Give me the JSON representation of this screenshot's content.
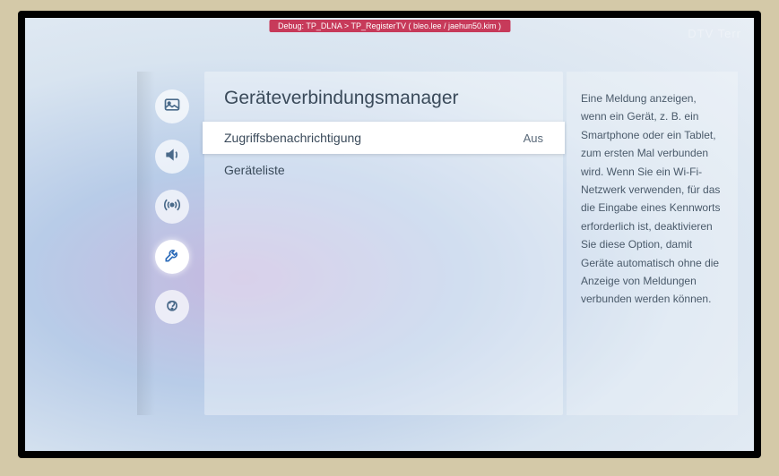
{
  "debug": {
    "text": "Debug: TP_DLNA > TP_RegisterTV  ( bleo.lee / jaehun50.kim )"
  },
  "topRight": "DTV Terr",
  "sidebar": {
    "items": [
      {
        "name": "picture-icon"
      },
      {
        "name": "sound-icon"
      },
      {
        "name": "broadcast-icon"
      },
      {
        "name": "general-icon"
      },
      {
        "name": "support-icon"
      }
    ],
    "activeIndex": 3
  },
  "panel": {
    "title": "Geräteverbindungsmanager",
    "items": [
      {
        "label": "Zugriffsbenachrichtigung",
        "value": "Aus",
        "selected": true
      },
      {
        "label": "Geräteliste",
        "value": "",
        "selected": false
      }
    ]
  },
  "help": {
    "text": "Eine Meldung anzeigen, wenn ein Gerät, z. B. ein Smartphone oder ein Tablet, zum ersten Mal verbunden wird. Wenn Sie ein Wi-Fi-Netzwerk verwenden, für das die Eingabe eines Kennworts erforderlich ist, deaktivieren Sie diese Option, damit Geräte automatisch ohne die Anzeige von Meldungen verbunden werden können."
  }
}
